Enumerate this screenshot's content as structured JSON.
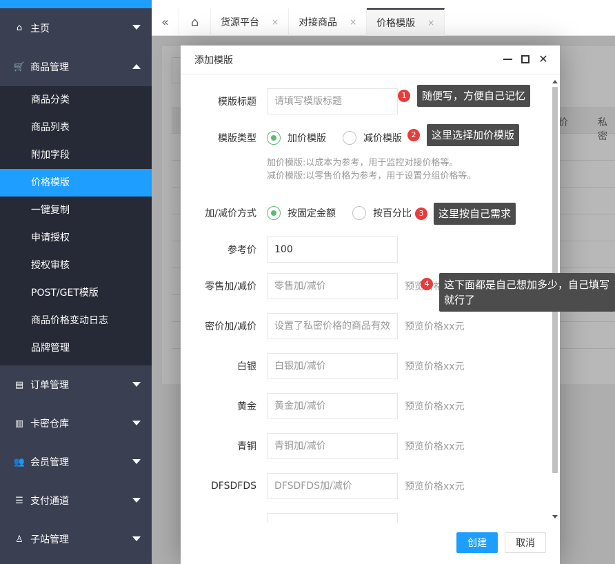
{
  "sidebar": {
    "groups": [
      {
        "label": "主页",
        "icon": "home-icon",
        "expanded": false
      },
      {
        "label": "商品管理",
        "icon": "cart-icon",
        "expanded": true
      },
      {
        "label": "订单管理",
        "icon": "clipboard-icon",
        "expanded": false
      },
      {
        "label": "卡密仓库",
        "icon": "folder-icon",
        "expanded": false
      },
      {
        "label": "会员管理",
        "icon": "users-icon",
        "expanded": false
      },
      {
        "label": "支付通道",
        "icon": "list-icon",
        "expanded": false
      },
      {
        "label": "子站管理",
        "icon": "sitemap-icon",
        "expanded": false
      }
    ],
    "subitems": [
      "商品分类",
      "商品列表",
      "附加字段",
      "价格模版",
      "一键复制",
      "申请授权",
      "授权审核",
      "POST/GET模版",
      "商品价格变动日志",
      "品牌管理"
    ],
    "active_subitem": "价格模版"
  },
  "tabs": {
    "items": [
      "货源平台",
      "对接商品",
      "价格模版"
    ],
    "close_glyph": "×",
    "active": "价格模版"
  },
  "page_peek": {
    "col1": "价",
    "col2": "私密"
  },
  "modal": {
    "title": "添加模版",
    "fields": {
      "title_label": "模版标题",
      "title_placeholder": "请填写模版标题",
      "type_label": "模版类型",
      "type_opt1": "加价模版",
      "type_opt2": "减价模版",
      "type_hint1": "加价模版:以成本为参考，用于监控对接价格等。",
      "type_hint2": "减价模版:以零售价格为参考，用于设置分组价格等。",
      "method_label": "加/减价方式",
      "method_opt1": "按固定金额",
      "method_opt2": "按百分比",
      "ref_label": "参考价",
      "ref_value": "100",
      "retail_label": "零售加/减价",
      "retail_placeholder": "零售加/减价",
      "retail_preview": "预览价格",
      "secret_label": "密价加/减价",
      "secret_placeholder": "设置了私密价格的商品有效",
      "silver_label": "白银",
      "silver_placeholder": "白银加/减价",
      "gold_label": "黄金",
      "gold_placeholder": "黄金加/减价",
      "bronze_label": "青铜",
      "bronze_placeholder": "青铜加/减价",
      "dfs_label": "DFSDFDS",
      "dfs_placeholder": "DFSDFDS加/减价",
      "preview_text": "预览价格xx元"
    },
    "create_button": "创建",
    "cancel_button": "取消"
  },
  "annotations": [
    {
      "num": "1",
      "text": "随便写，方便自己记忆"
    },
    {
      "num": "2",
      "text": "这里选择加价模版"
    },
    {
      "num": "3",
      "text": "这里按自己需求"
    },
    {
      "num": "4",
      "text": "这下面都是自己想加多少，自己填写就行了"
    }
  ],
  "colors": {
    "sidebar": "#3a3f51",
    "subnav": "#252a36",
    "accent": "#1e9fff",
    "radio_on": "#5fb878",
    "badge": "#e43d3d",
    "tooltip": "#4c4c4c"
  }
}
